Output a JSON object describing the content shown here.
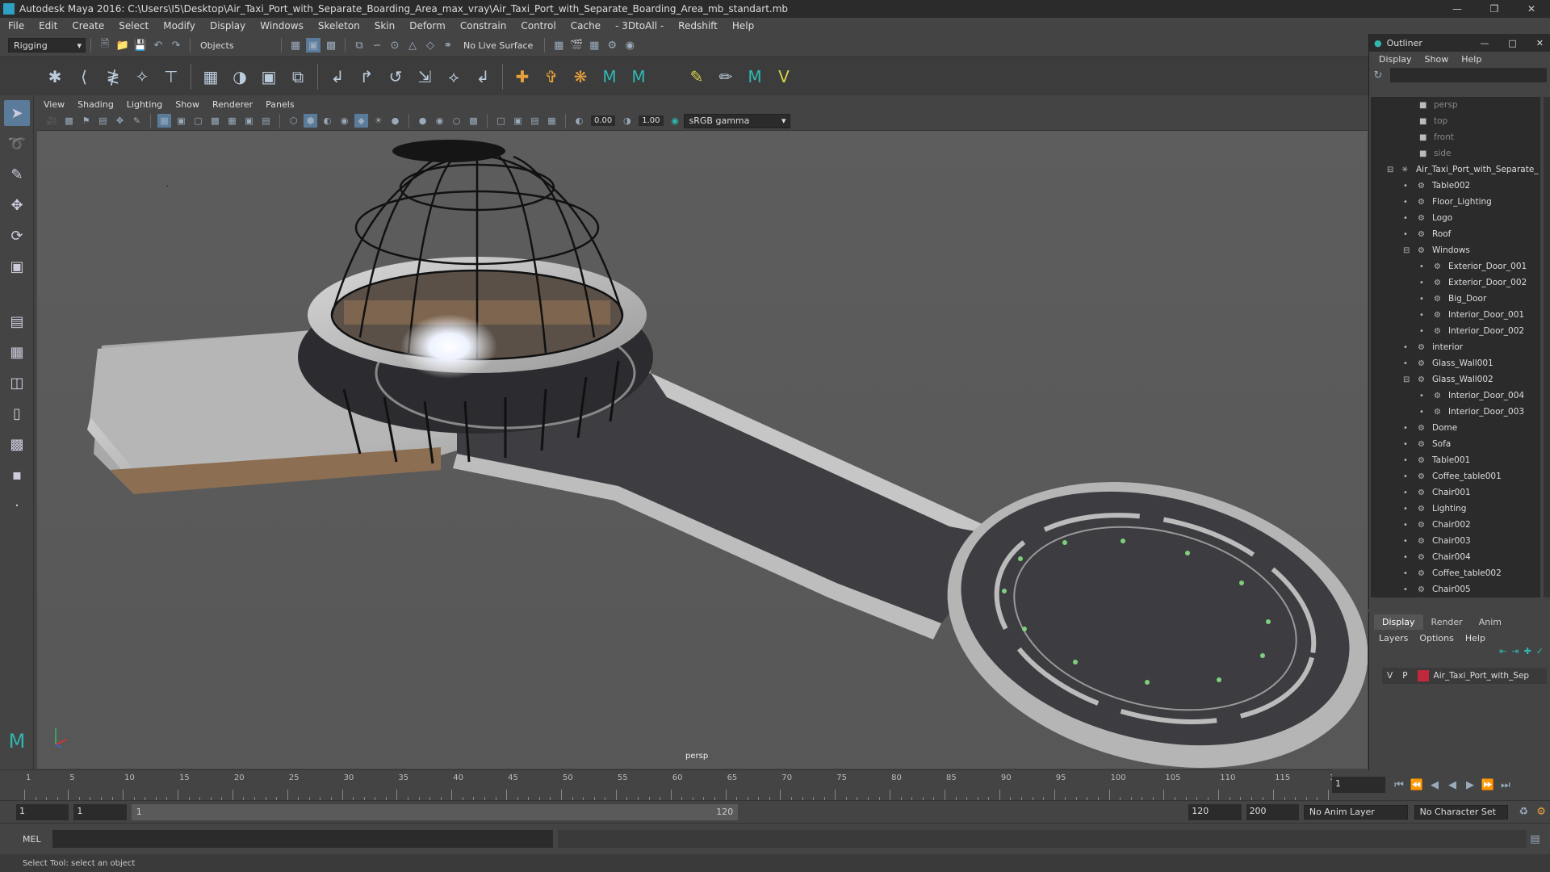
{
  "title": "Autodesk Maya 2016: C:\\Users\\I5\\Desktop\\Air_Taxi_Port_with_Separate_Boarding_Area_max_vray\\Air_Taxi_Port_with_Separate_Boarding_Area_mb_standart.mb",
  "menus": [
    "File",
    "Edit",
    "Create",
    "Select",
    "Modify",
    "Display",
    "Windows",
    "Skeleton",
    "Skin",
    "Deform",
    "Constrain",
    "Control",
    "Cache",
    "- 3DtoAll -",
    "Redshift",
    "Help"
  ],
  "status": {
    "mode": "Rigging",
    "selection": "Objects",
    "live_surface": "No Live Surface"
  },
  "viewport_menu": [
    "View",
    "Shading",
    "Lighting",
    "Show",
    "Renderer",
    "Panels"
  ],
  "viewport_toolbar": {
    "exposure": "0.00",
    "gamma": "1.00",
    "color_space": "sRGB gamma"
  },
  "viewport_label": "persp",
  "timeline": {
    "ticks": [
      "1",
      "5",
      "10",
      "15",
      "20",
      "25",
      "30",
      "35",
      "40",
      "45",
      "50",
      "55",
      "60",
      "65",
      "70",
      "75",
      "80",
      "85",
      "90",
      "95",
      "100",
      "105",
      "110",
      "115",
      "120"
    ],
    "current_frame": "1"
  },
  "range": {
    "start": "1",
    "playback_start": "1",
    "slider_start": "1",
    "slider_end": "120",
    "playback_end": "120",
    "end": "200",
    "anim_layer": "No Anim Layer",
    "character_set": "No Character Set"
  },
  "mel_label": "MEL",
  "help_line": "Select Tool: select an object",
  "outliner": {
    "title": "Outliner",
    "menu": [
      "Display",
      "Show",
      "Help"
    ],
    "items": [
      {
        "label": "persp",
        "cam": true,
        "indent": 0
      },
      {
        "label": "top",
        "cam": true,
        "indent": 0
      },
      {
        "label": "front",
        "cam": true,
        "indent": 0
      },
      {
        "label": "side",
        "cam": true,
        "indent": 0
      },
      {
        "label": "Air_Taxi_Port_with_Separate_",
        "indent": 0,
        "exp": true
      },
      {
        "label": "Table002",
        "indent": 1
      },
      {
        "label": "Floor_Lighting",
        "indent": 1
      },
      {
        "label": "Logo",
        "indent": 1
      },
      {
        "label": "Roof",
        "indent": 1
      },
      {
        "label": "Windows",
        "indent": 1,
        "exp": true
      },
      {
        "label": "Exterior_Door_001",
        "indent": 2
      },
      {
        "label": "Exterior_Door_002",
        "indent": 2
      },
      {
        "label": "Big_Door",
        "indent": 2
      },
      {
        "label": "Interior_Door_001",
        "indent": 2
      },
      {
        "label": "Interior_Door_002",
        "indent": 2
      },
      {
        "label": "interior",
        "indent": 1
      },
      {
        "label": "Glass_Wall001",
        "indent": 1
      },
      {
        "label": "Glass_Wall002",
        "indent": 1,
        "exp": true
      },
      {
        "label": "Interior_Door_004",
        "indent": 2
      },
      {
        "label": "Interior_Door_003",
        "indent": 2
      },
      {
        "label": "Dome",
        "indent": 1
      },
      {
        "label": "Sofa",
        "indent": 1
      },
      {
        "label": "Table001",
        "indent": 1
      },
      {
        "label": "Coffee_table001",
        "indent": 1
      },
      {
        "label": "Chair001",
        "indent": 1
      },
      {
        "label": "Lighting",
        "indent": 1
      },
      {
        "label": "Chair002",
        "indent": 1
      },
      {
        "label": "Chair003",
        "indent": 1
      },
      {
        "label": "Chair004",
        "indent": 1
      },
      {
        "label": "Coffee_table002",
        "indent": 1
      },
      {
        "label": "Chair005",
        "indent": 1
      }
    ]
  },
  "layers": {
    "tabs": [
      "Display",
      "Render",
      "Anim"
    ],
    "menu": [
      "Layers",
      "Options",
      "Help"
    ],
    "row": {
      "v": "V",
      "p": "P",
      "name": "Air_Taxi_Port_with_Sep",
      "color": "#c0283c"
    }
  }
}
